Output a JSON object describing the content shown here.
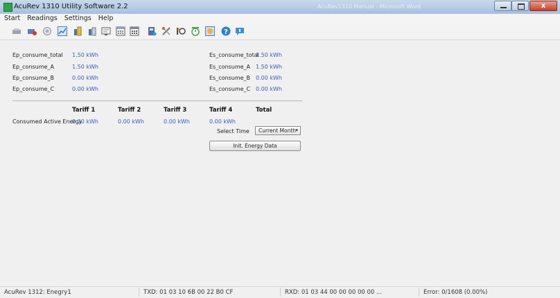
{
  "window": {
    "title": "AcuRev 1310 Utility Software 2.2",
    "background_title": "AcuRev1310 Manual - Microsoft Word",
    "close_glyph": "x"
  },
  "menu": [
    "Start",
    "Readings",
    "Settings",
    "Help"
  ],
  "toolbar_icons": [
    "connect-icon",
    "disconnect-icon",
    "search-device-icon",
    "chart-icon",
    "meter-icon",
    "meter-alt-icon",
    "report-icon",
    "calendar-icon",
    "calendar-grid-icon",
    "device-info-icon",
    "tools-icon",
    "io-icon",
    "timer-icon",
    "log-icon",
    "help-icon",
    "about-icon"
  ],
  "energy": {
    "ep": [
      {
        "label": "Ep_consume_total",
        "value": "1.50 kWh"
      },
      {
        "label": "Ep_consume_A",
        "value": "1.50 kWh"
      },
      {
        "label": "Ep_consume_B",
        "value": "0.00 kWh"
      },
      {
        "label": "Ep_consume_C",
        "value": "0.00 kWh"
      }
    ],
    "es": [
      {
        "label": "Es_consume_total",
        "value": "1.50 kWh"
      },
      {
        "label": "Es_consume_A",
        "value": "1.50 kWh"
      },
      {
        "label": "Es_consume_B",
        "value": "0.00 kWh"
      },
      {
        "label": "Es_consume_C",
        "value": "0.00 kWh"
      }
    ]
  },
  "tariff": {
    "headers": [
      "Tariff 1",
      "Tariff 2",
      "Tariff 3",
      "Tariff 4",
      "Total"
    ],
    "row_label": "Consumed Active Energy",
    "values": [
      "0.00 kWh",
      "0.00 kWh",
      "0.00 kWh",
      "0.00 kWh"
    ]
  },
  "select_time": {
    "label": "Select Time",
    "value": "Current Month"
  },
  "init_button": "Init. Energy Data",
  "status": {
    "device": "AcuRev 1312: Enegry1",
    "txd": "TXD:  01 03 10 6B 00 22 B0 CF",
    "rxd": "RXD:  01 03 44 00 00 00 00 00 ...",
    "error": "Error:  0/1608  (0.00%)"
  }
}
